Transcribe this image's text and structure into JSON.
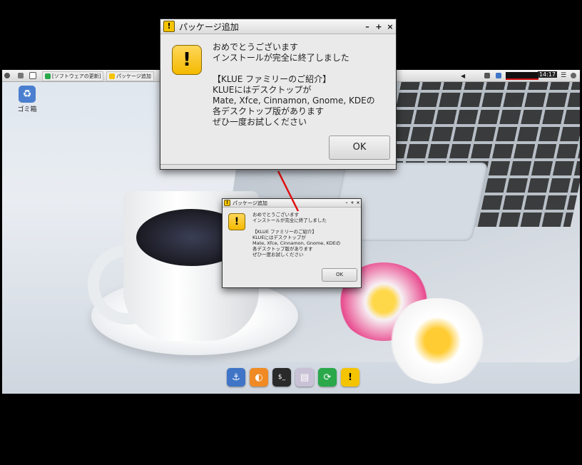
{
  "panel": {
    "tasks": [
      {
        "label": "[ソフトウェアの更新]",
        "icon": "update-icon"
      },
      {
        "label": "パッケージ追加",
        "icon": "warning-icon"
      }
    ],
    "clock": "14:17"
  },
  "desktop": {
    "trash_label": "ゴミ箱"
  },
  "dock": [
    {
      "icon": "anchor-icon",
      "glyph": "⚓",
      "color": "#3f74c6"
    },
    {
      "icon": "software-center-icon",
      "glyph": "◐",
      "color": "#f08a24"
    },
    {
      "icon": "terminal-icon",
      "glyph": "$_",
      "color": "#2a2a2a"
    },
    {
      "icon": "files-icon",
      "glyph": "▤",
      "color": "#c9c2d6"
    },
    {
      "icon": "refresh-icon",
      "glyph": "⟳",
      "color": "#2aa84a"
    },
    {
      "icon": "warning-icon",
      "glyph": "!",
      "color": "#f5c400"
    }
  ],
  "dialog": {
    "title": "パッケージ追加",
    "warn_glyph": "!",
    "controls": {
      "minimize": "–",
      "maximize": "+",
      "close": "×"
    },
    "message": "おめでとうございます\nインストールが完全に終了しました\n\n【KLUE ファミリーのご紹介】\nKLUEにはデスクトップが\nMate, Xfce, Cinnamon, Gnome, KDEの\n各デスクトップ版があります\nぜひ一度お試しください",
    "ok_label": "OK"
  },
  "colors": {
    "annotation_arrow": "#e01010",
    "warning_yellow": "#f5c400"
  }
}
